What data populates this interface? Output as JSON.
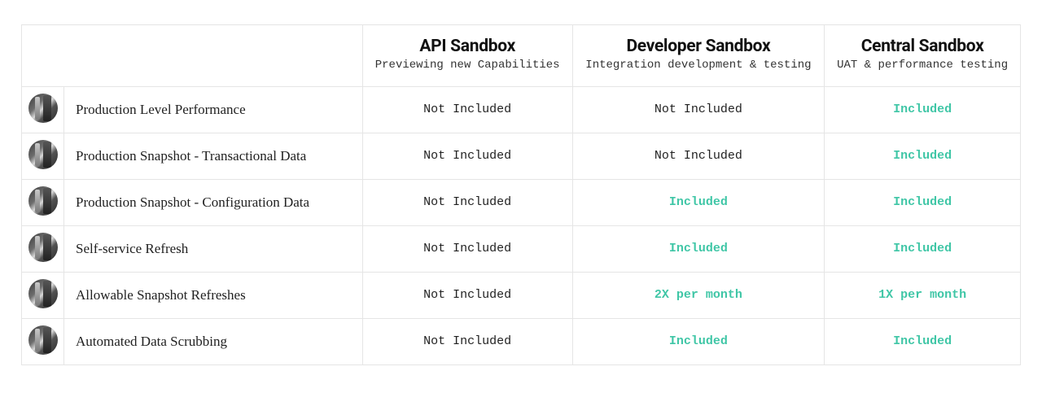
{
  "columns": [
    {
      "title": "API Sandbox",
      "subtitle": "Previewing new Capabilities"
    },
    {
      "title": "Developer Sandbox",
      "subtitle": "Integration development & testing"
    },
    {
      "title": "Central Sandbox",
      "subtitle": "UAT & performance testing"
    }
  ],
  "rows": [
    {
      "feature": "Production Level Performance",
      "cells": [
        {
          "text": "Not Included",
          "included": false
        },
        {
          "text": "Not Included",
          "included": false
        },
        {
          "text": "Included",
          "included": true
        }
      ]
    },
    {
      "feature": "Production Snapshot - Transactional Data",
      "cells": [
        {
          "text": "Not Included",
          "included": false
        },
        {
          "text": "Not Included",
          "included": false
        },
        {
          "text": "Included",
          "included": true
        }
      ]
    },
    {
      "feature": "Production Snapshot - Configuration Data",
      "cells": [
        {
          "text": "Not Included",
          "included": false
        },
        {
          "text": "Included",
          "included": true
        },
        {
          "text": "Included",
          "included": true
        }
      ]
    },
    {
      "feature": "Self-service Refresh",
      "cells": [
        {
          "text": "Not Included",
          "included": false
        },
        {
          "text": "Included",
          "included": true
        },
        {
          "text": "Included",
          "included": true
        }
      ]
    },
    {
      "feature": "Allowable Snapshot Refreshes",
      "cells": [
        {
          "text": "Not Included",
          "included": false
        },
        {
          "text": "2X per month",
          "included": true
        },
        {
          "text": "1X per month",
          "included": true
        }
      ]
    },
    {
      "feature": "Automated Data Scrubbing",
      "cells": [
        {
          "text": "Not Included",
          "included": false
        },
        {
          "text": "Included",
          "included": true
        },
        {
          "text": "Included",
          "included": true
        }
      ]
    }
  ]
}
